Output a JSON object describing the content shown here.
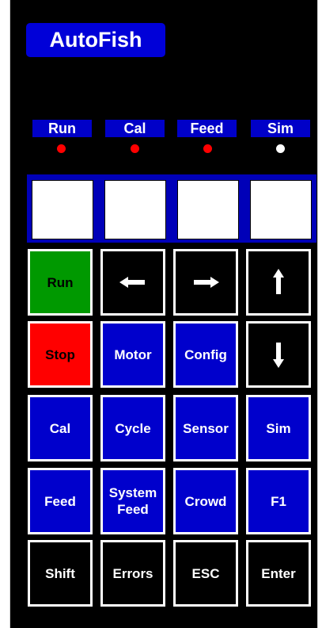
{
  "title": "AutoFish",
  "colors": {
    "background": "#000000",
    "blue": "#0000cc",
    "green": "#009900",
    "red": "#ff0000",
    "led_on": "#ff0000",
    "led_off": "#ffffff"
  },
  "indicators": [
    {
      "label": "Run",
      "state": "on"
    },
    {
      "label": "Cal",
      "state": "on"
    },
    {
      "label": "Feed",
      "state": "on"
    },
    {
      "label": "Sim",
      "state": "off"
    }
  ],
  "screens": [
    {
      "text": ""
    },
    {
      "text": ""
    },
    {
      "text": ""
    },
    {
      "text": ""
    }
  ],
  "keys": {
    "row1": [
      {
        "label": "Run",
        "color": "#009900"
      },
      {
        "icon": "arrow-left-icon",
        "color": "#000000"
      },
      {
        "icon": "arrow-right-icon",
        "color": "#000000"
      },
      {
        "icon": "arrow-up-icon",
        "color": "#000000"
      }
    ],
    "row2": [
      {
        "label": "Stop",
        "color": "#ff0000"
      },
      {
        "label": "Motor",
        "color": "#0000cc"
      },
      {
        "label": "Config",
        "color": "#0000cc"
      },
      {
        "icon": "arrow-down-icon",
        "color": "#000000"
      }
    ],
    "row3": [
      {
        "label": "Cal",
        "color": "#0000cc"
      },
      {
        "label": "Cycle",
        "color": "#0000cc"
      },
      {
        "label": "Sensor",
        "color": "#0000cc"
      },
      {
        "label": "Sim",
        "color": "#0000cc"
      }
    ],
    "row4": [
      {
        "label": "Feed",
        "color": "#0000cc"
      },
      {
        "label": "System\nFeed",
        "color": "#0000cc"
      },
      {
        "label": "Crowd",
        "color": "#0000cc"
      },
      {
        "label": "F1",
        "color": "#0000cc"
      }
    ],
    "row5": [
      {
        "label": "Shift",
        "color": "#000000"
      },
      {
        "label": "Errors",
        "color": "#000000"
      },
      {
        "label": "ESC",
        "color": "#000000"
      },
      {
        "label": "Enter",
        "color": "#000000"
      }
    ]
  }
}
